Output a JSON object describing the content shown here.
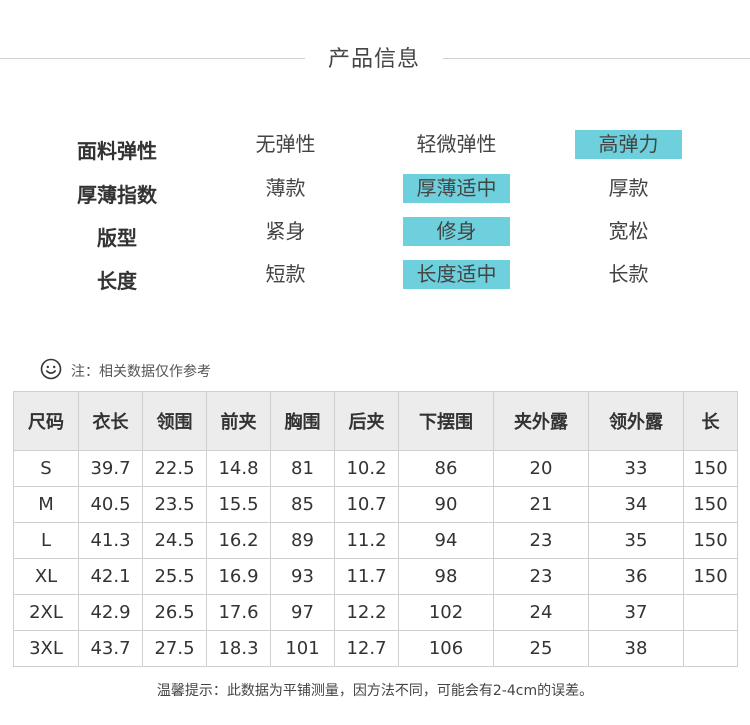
{
  "section_title": "产品信息",
  "attributes": [
    {
      "label": "面料弹性",
      "options": [
        "无弹性",
        "轻微弹性",
        "高弹力"
      ],
      "selected": 2
    },
    {
      "label": "厚薄指数",
      "options": [
        "薄款",
        "厚薄适中",
        "厚款"
      ],
      "selected": 1
    },
    {
      "label": "版型",
      "options": [
        "紧身",
        "修身",
        "宽松"
      ],
      "selected": 1
    },
    {
      "label": "长度",
      "options": [
        "短款",
        "长度适中",
        "长款"
      ],
      "selected": 1
    }
  ],
  "highlight_color": "#6dd0dc",
  "note": "注：相关数据仅作参考",
  "note_icon": "smiley-icon",
  "size_table": {
    "headers": [
      "尺码",
      "衣长",
      "领围",
      "前夹",
      "胸围",
      "后夹",
      "下摆围",
      "夹外露",
      "领外露",
      "长"
    ],
    "rows": [
      [
        "S",
        "39.7",
        "22.5",
        "14.8",
        "81",
        "10.2",
        "86",
        "20",
        "33",
        "150"
      ],
      [
        "M",
        "40.5",
        "23.5",
        "15.5",
        "85",
        "10.7",
        "90",
        "21",
        "34",
        "150"
      ],
      [
        "L",
        "41.3",
        "24.5",
        "16.2",
        "89",
        "11.2",
        "94",
        "23",
        "35",
        "150"
      ],
      [
        "XL",
        "42.1",
        "25.5",
        "16.9",
        "93",
        "11.7",
        "98",
        "23",
        "36",
        "150"
      ],
      [
        "2XL",
        "42.9",
        "26.5",
        "17.6",
        "97",
        "12.2",
        "102",
        "24",
        "37",
        ""
      ],
      [
        "3XL",
        "43.7",
        "27.5",
        "18.3",
        "101",
        "12.7",
        "106",
        "25",
        "38",
        ""
      ]
    ]
  },
  "footer_note": "温馨提示：此数据为平铺测量，因方法不同，可能会有2-4cm的误差。"
}
